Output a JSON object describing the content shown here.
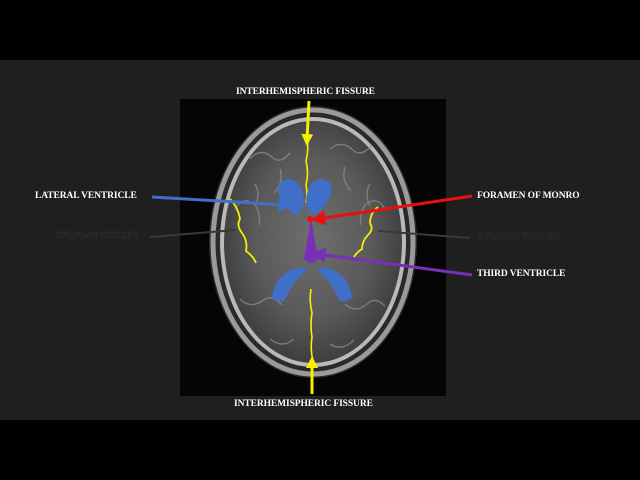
{
  "labels": {
    "interhemispheric_top": "INTERHEMISPHERIC FISSURE",
    "interhemispheric_bottom": "INTERHEMISPHERIC FISSURE",
    "lateral_ventricle": "LATERAL VENTRICLE",
    "foramen_of_monro": "FORAMEN OF MONRO",
    "third_ventricle": "THIRD VENTRICLE",
    "sylvian_fissure_left": "SYLVIAN FISSURE",
    "sylvian_fissure_right": "SYLVIAN FISSURE"
  },
  "colors": {
    "background": "#1f1f1f",
    "letterbox": "#000000",
    "fissure_highlight": "#f4f000",
    "lateral_ventricle_highlight": "#3f6fc8",
    "foramen_highlight": "#e81010",
    "third_ventricle_highlight": "#7a2fb8",
    "label_text": "#ffffff"
  }
}
